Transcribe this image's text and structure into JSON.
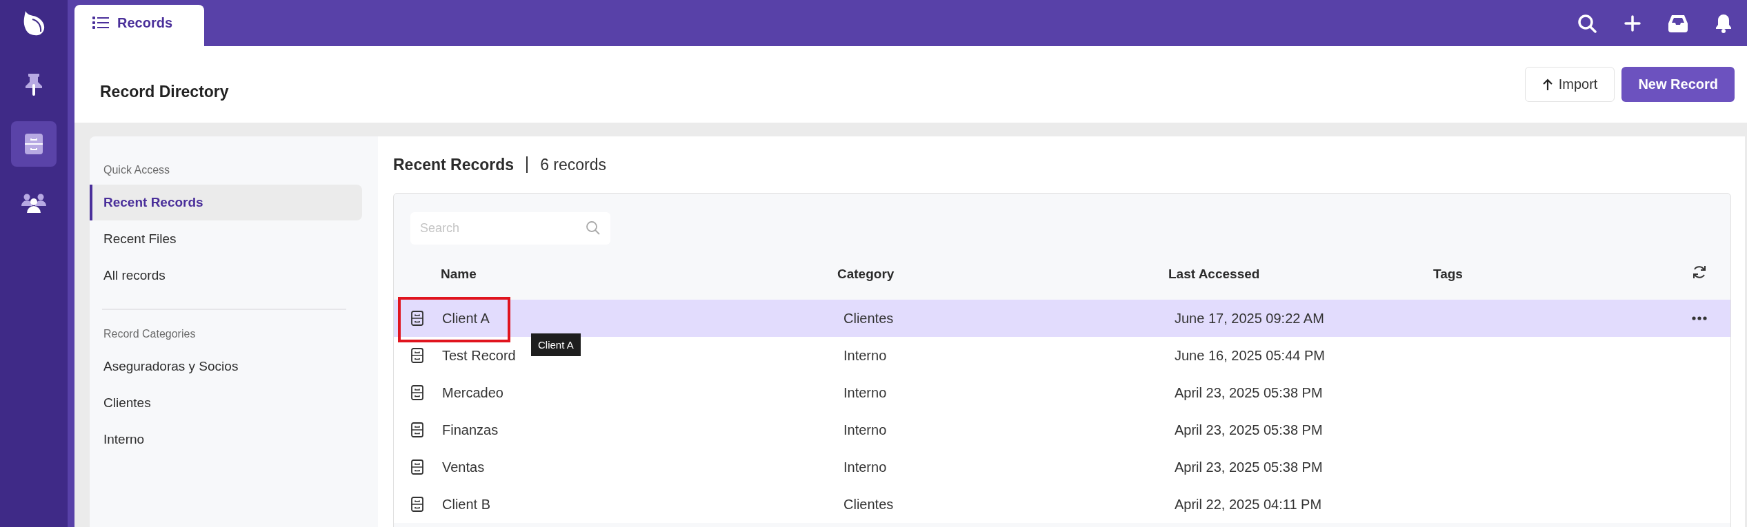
{
  "nav_rail": {
    "items": [
      {
        "kind": "pin",
        "selected": false
      },
      {
        "kind": "cabinet",
        "selected": true
      },
      {
        "kind": "people",
        "selected": false
      }
    ]
  },
  "tabs": [
    {
      "label": "Records",
      "selected": true
    }
  ],
  "header": {
    "title": "Record Directory",
    "buttons": [
      {
        "label": "Import",
        "kind": "secondary"
      },
      {
        "label": "New Record",
        "kind": "primary"
      }
    ]
  },
  "sidebar": {
    "sections": [
      {
        "heading": "Quick Access",
        "items": [
          {
            "label": "Recent Records",
            "selected": true
          },
          {
            "label": "Recent Files",
            "selected": false
          },
          {
            "label": "All records",
            "selected": false
          }
        ]
      },
      {
        "heading": "Record Categories",
        "items": [
          {
            "label": "Aseguradoras y Socios",
            "selected": false
          },
          {
            "label": "Clientes",
            "selected": false
          },
          {
            "label": "Interno",
            "selected": false
          }
        ]
      }
    ]
  },
  "content": {
    "title": "Recent Records",
    "count": "6 records",
    "search": {
      "placeholder": "Search"
    },
    "table": {
      "columns": [
        "Name",
        "Category",
        "Last Accessed",
        "Tags"
      ],
      "rows": [
        {
          "name": "Client A",
          "category": "Clientes",
          "last_accessed": "June 17, 2025 09:22 AM",
          "selected": true
        },
        {
          "name": "Test Record",
          "category": "Interno",
          "last_accessed": "June 16, 2025 05:44 PM",
          "selected": false
        },
        {
          "name": "Mercadeo",
          "category": "Interno",
          "last_accessed": "April 23, 2025 05:38 PM",
          "selected": false
        },
        {
          "name": "Finanzas",
          "category": "Interno",
          "last_accessed": "April 23, 2025 05:38 PM",
          "selected": false
        },
        {
          "name": "Ventas",
          "category": "Interno",
          "last_accessed": "April 23, 2025 05:38 PM",
          "selected": false
        },
        {
          "name": "Client B",
          "category": "Clientes",
          "last_accessed": "April 22, 2025 04:11 PM",
          "selected": false
        }
      ]
    },
    "tooltip": "Client A"
  }
}
